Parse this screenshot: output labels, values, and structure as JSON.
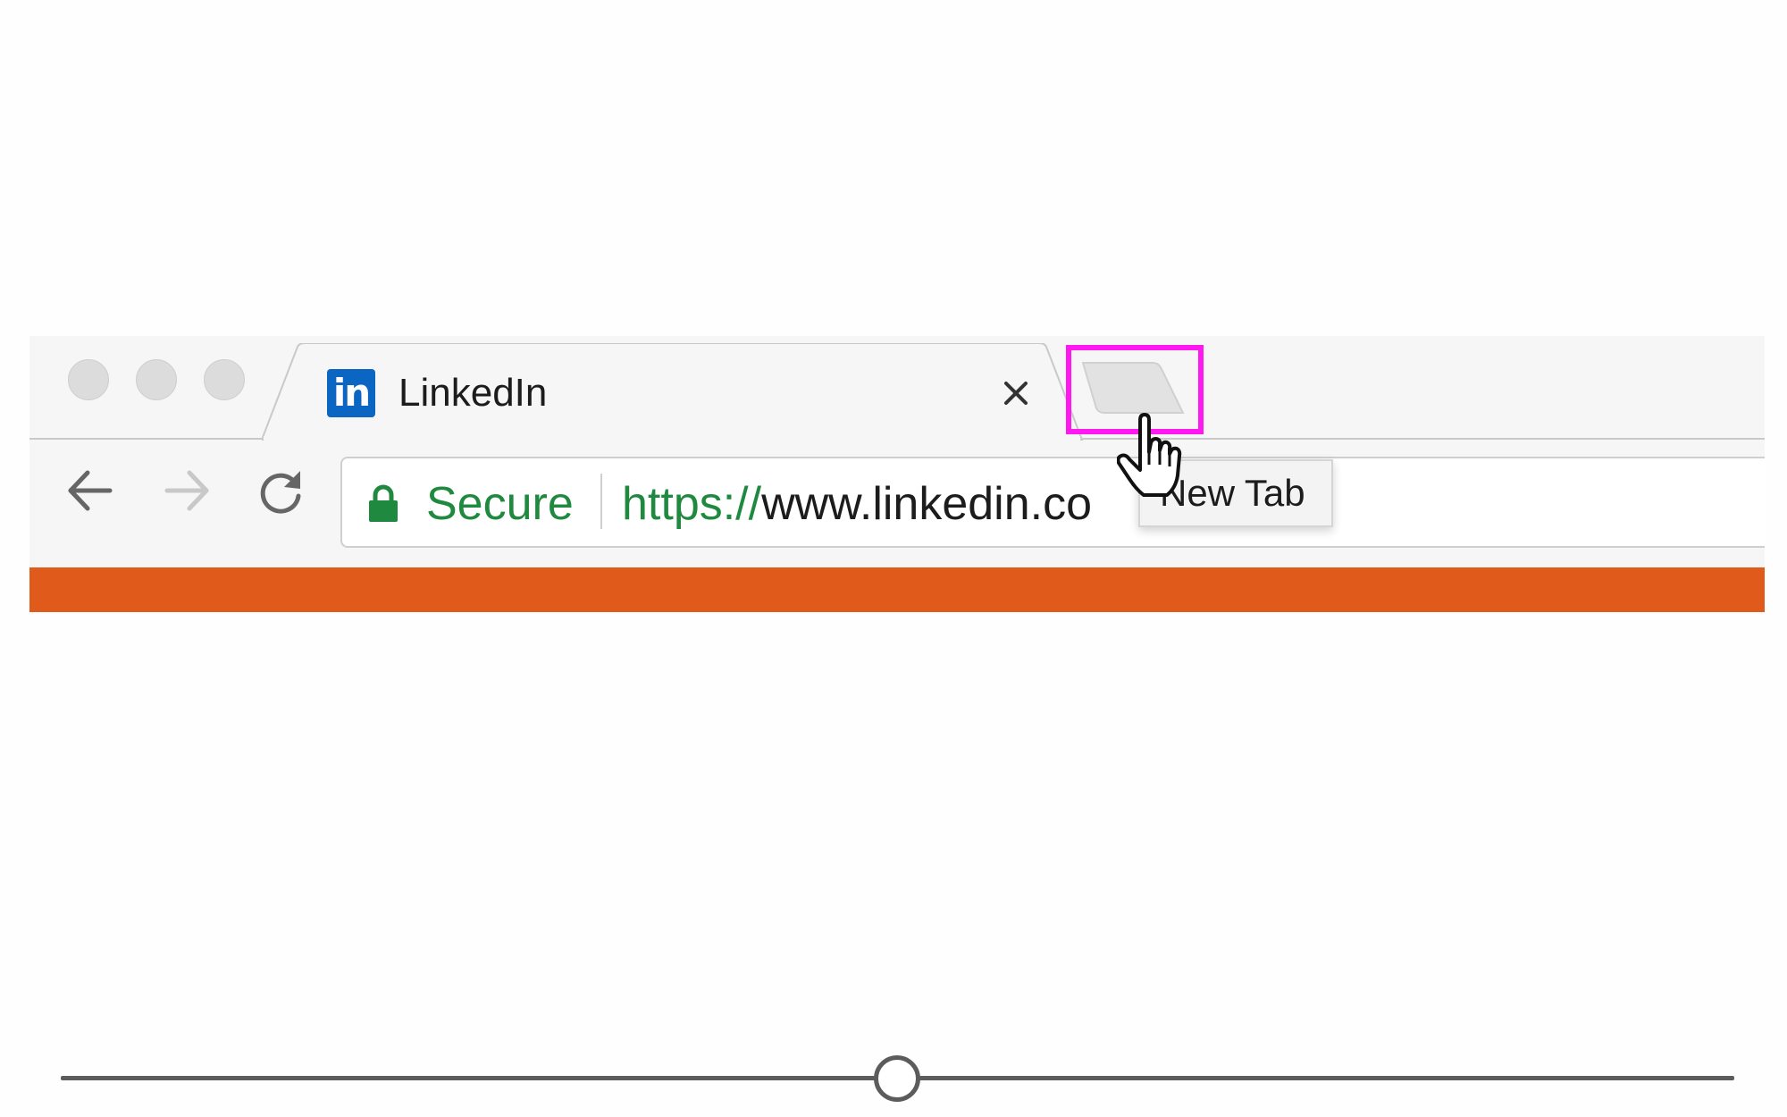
{
  "window": {
    "traffic_lights": [
      "close",
      "minimize",
      "zoom"
    ]
  },
  "tab": {
    "title": "LinkedIn",
    "favicon_text": "in",
    "favicon_color": "#0a66c2",
    "close_icon": "close-icon"
  },
  "new_tab": {
    "tooltip": "New Tab",
    "highlight_color": "#ff19f0"
  },
  "toolbar": {
    "back_icon": "arrow-left-icon",
    "forward_icon": "arrow-right-icon",
    "reload_icon": "reload-icon"
  },
  "omnibox": {
    "security_label": "Secure",
    "url_scheme": "https://",
    "url_rest": "www.linkedin.co",
    "secure_color": "#1f8a3f"
  },
  "page": {
    "header_color": "#e05a1c"
  },
  "slider": {
    "value": 0.5
  }
}
